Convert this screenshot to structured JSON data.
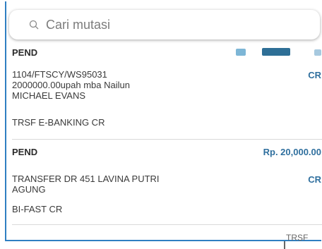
{
  "search": {
    "placeholder": "Cari mutasi"
  },
  "transactions": [
    {
      "status": "PEND",
      "lines": [
        "1104/FTSCY/WS95031",
        "2000000.00upah mba Nailun",
        "MICHAEL EVANS"
      ],
      "type": "TRSF E-BANKING CR",
      "cr_label": "CR"
    },
    {
      "status": "PEND",
      "amount": "Rp. 20,000.00",
      "lines": [
        "TRANSFER   DR 451 LAVINA PUTRI",
        "AGUNG"
      ],
      "type": "BI-FAST CR",
      "cr_label": "CR"
    }
  ],
  "footer": {
    "partial_text": "TRSF"
  },
  "colors": {
    "accent": "#2f7fc2",
    "amount": "#2f6f9e"
  }
}
